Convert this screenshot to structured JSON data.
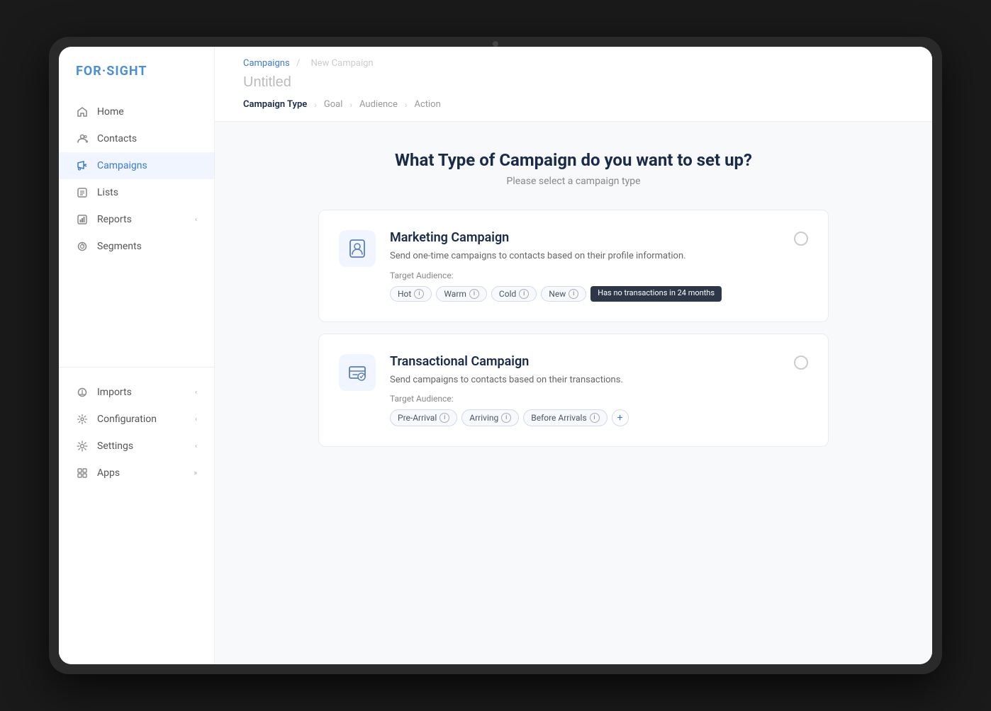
{
  "device": {
    "camera": true
  },
  "logo": {
    "text_for": "FOR",
    "text_sight": "·SIGHT"
  },
  "sidebar": {
    "nav_items": [
      {
        "id": "home",
        "label": "Home",
        "icon": "home-icon"
      },
      {
        "id": "contacts",
        "label": "Contacts",
        "icon": "contacts-icon"
      },
      {
        "id": "campaigns",
        "label": "Campaigns",
        "icon": "campaigns-icon",
        "active": true
      },
      {
        "id": "lists",
        "label": "Lists",
        "icon": "lists-icon"
      },
      {
        "id": "reports",
        "label": "Reports",
        "icon": "reports-icon",
        "has_chevron": true
      },
      {
        "id": "segments",
        "label": "Segments",
        "icon": "segments-icon"
      }
    ],
    "bottom_items": [
      {
        "id": "imports",
        "label": "Imports",
        "icon": "imports-icon",
        "has_chevron": true
      },
      {
        "id": "configuration",
        "label": "Configuration",
        "icon": "configuration-icon",
        "has_chevron": true
      },
      {
        "id": "settings",
        "label": "Settings",
        "icon": "settings-icon",
        "has_chevron": true
      },
      {
        "id": "apps",
        "label": "Apps",
        "icon": "apps-icon",
        "has_chevron": true,
        "chevron_double": true
      }
    ]
  },
  "breadcrumb": {
    "parent": "Campaigns",
    "separator": "/",
    "current": "New Campaign"
  },
  "page_title": "Untitled",
  "steps": [
    {
      "id": "campaign-type",
      "label": "Campaign Type",
      "active": true
    },
    {
      "id": "goal",
      "label": "Goal",
      "active": false
    },
    {
      "id": "audience",
      "label": "Audience",
      "active": false
    },
    {
      "id": "action",
      "label": "Action",
      "active": false
    }
  ],
  "main": {
    "title": "What Type of Campaign do you want to set up?",
    "subtitle": "Please select a campaign type",
    "cards": [
      {
        "id": "marketing",
        "title": "Marketing Campaign",
        "description": "Send one-time campaigns to contacts based on their profile information.",
        "target_label": "Target Audience:",
        "tags": [
          {
            "label": "Hot",
            "has_info": true
          },
          {
            "label": "Warm",
            "has_info": true
          },
          {
            "label": "Cold",
            "has_info": true
          },
          {
            "label": "New",
            "has_info": true
          }
        ],
        "extra_tag": {
          "label": "Has no transactions in 24 months",
          "is_tooltip": true
        },
        "selected": false
      },
      {
        "id": "transactional",
        "title": "Transactional Campaign",
        "description": "Send campaigns to contacts based on their transactions.",
        "target_label": "Target Audience:",
        "tags": [
          {
            "label": "Pre-Arrival",
            "has_info": true
          },
          {
            "label": "Arriving",
            "has_info": true
          },
          {
            "label": "Before Arrivals",
            "has_info": true
          }
        ],
        "has_plus": true,
        "selected": false
      }
    ]
  }
}
